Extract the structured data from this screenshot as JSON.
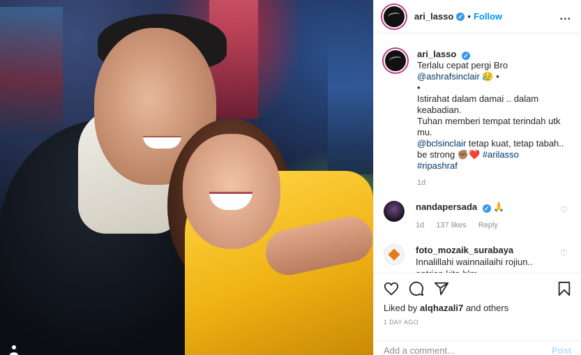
{
  "photo": {
    "alt": "",
    "tag_icon": "person-tag-icon"
  },
  "header": {
    "username": "ari_lasso",
    "verified_icon": "verified-badge-icon",
    "separator": "•",
    "follow_label": "Follow",
    "more_icon": "more-options-icon",
    "more_label": "..."
  },
  "caption": {
    "username": "ari_lasso",
    "line1": "Terlalu cepat pergi Bro",
    "mention1": "@ashrafsinclair",
    "emoji1": "😥",
    "bullet": "•",
    "line2": "Istirahat dalam damai .. dalam keabadian.",
    "line3": "Tuhan memberi tempat terindah utk mu.",
    "mention2": "@bclsinclair",
    "line4": "tetap kuat, tetap tabah.. be strong",
    "emoji2": "✊🏽❤️",
    "hashtag1": "#arilasso",
    "hashtag2": "#ripashraf",
    "time": "1d"
  },
  "comments": [
    {
      "username": "nandapersada",
      "text": "🙏",
      "time": "1d",
      "likes": "137 likes",
      "reply": "Reply"
    },
    {
      "username": "foto_mozaik_surabaya",
      "text": "Innalillahi wainnailaihi rojiun.. antrian kita blm",
      "time": "",
      "likes": "",
      "reply": ""
    }
  ],
  "actions": {
    "liked_prefix": "Liked by",
    "liked_user": "alqhazali7",
    "liked_suffix": "and others",
    "ago": "1 DAY AGO"
  },
  "add_comment": {
    "placeholder": "Add a comment...",
    "post_label": "Post"
  },
  "colors": {
    "link": "#00376b",
    "follow": "#0095f6",
    "verified": "#3897f0",
    "post_disabled": "#b2dffc"
  }
}
